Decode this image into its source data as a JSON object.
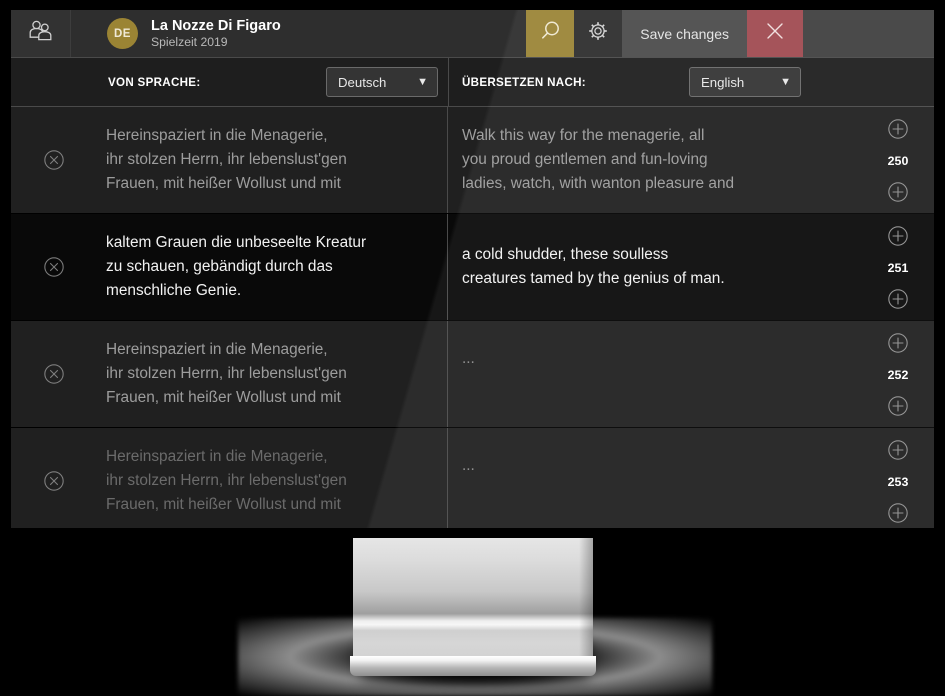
{
  "header": {
    "users_icon": "users-icon",
    "avatar_initials": "DE",
    "title": "La Nozze Di Figaro",
    "subtitle": "Spielzeit 2019",
    "search_icon": "search-icon",
    "settings_icon": "gear-icon",
    "save_label": "Save changes",
    "close_icon": "close-icon",
    "colors": {
      "accent_gold": "#9b8436",
      "avatar_gold": "#9b8434",
      "close_red": "#a04a50",
      "header_bg": "#2e2e2e",
      "panel_bg": "#1c1c1c"
    }
  },
  "language_bar": {
    "source_label": "VON SPRACHE:",
    "source_value": "Deutsch",
    "target_label": "ÜBERSETZEN NACH:",
    "target_value": "English",
    "caret": "▼"
  },
  "rows": [
    {
      "number": "250",
      "source": "Hereinspaziert in die Menagerie,\nihr stolzen Herrn, ihr lebenslust'gen\nFrauen, mit heißer Wollust und mit",
      "target": "Walk this way for the menagerie, all\nyou proud gentlemen and fun-loving\nladies, watch, with wanton pleasure and",
      "active": false,
      "faded": false
    },
    {
      "number": "251",
      "source": "kaltem Grauen die unbeseelte Kreatur\nzu schauen, gebändigt durch das\nmenschliche Genie.",
      "target": "a cold shudder, these soulless\ncreatures tamed by the genius of man.",
      "active": true,
      "faded": false
    },
    {
      "number": "252",
      "source": "Hereinspaziert in die Menagerie,\nihr stolzen Herrn, ihr lebenslust'gen\nFrauen, mit heißer Wollust und mit",
      "target": "...",
      "active": false,
      "faded": false
    },
    {
      "number": "253",
      "source": "Hereinspaziert in die Menagerie,\nihr stolzen Herrn, ihr lebenslust'gen\nFrauen, mit heißer Wollust und mit",
      "target": "...",
      "active": false,
      "faded": true
    }
  ],
  "row_icons": {
    "delete_icon": "circle-x-icon",
    "add_above_icon": "circle-plus-icon",
    "add_below_icon": "circle-plus-icon"
  }
}
